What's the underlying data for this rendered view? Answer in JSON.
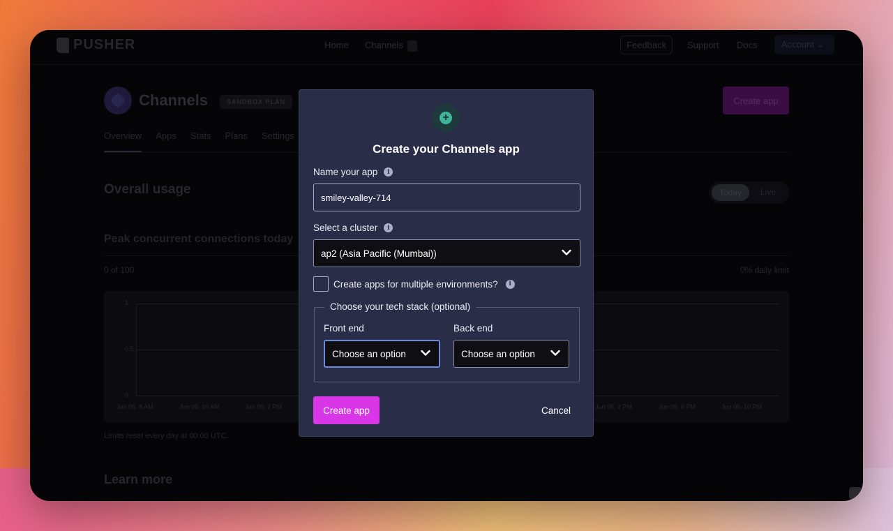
{
  "background_page": {
    "logo_text": "PUSHER",
    "nav": {
      "home": "Home",
      "channels": "Channels",
      "feedback": "Feedback",
      "support": "Support",
      "docs": "Docs",
      "account": "Account"
    },
    "page_title": "Channels",
    "plan_badge": "SANDBOX PLAN",
    "create_app_button": "Create app",
    "tabs": [
      "Overview",
      "Apps",
      "Stats",
      "Plans",
      "Settings"
    ],
    "section_title": "Overall usage",
    "toggle": {
      "today": "Today",
      "live": "Live"
    },
    "subsection_title": "Peak concurrent connections today",
    "count_text": "0 of 100",
    "limit_text": "0% daily limit",
    "chart_y_ticks": [
      "1",
      "0.5",
      "0"
    ],
    "chart_x_ticks": [
      "Jun 05, 8 AM",
      "Jun 05, 10 AM",
      "Jun 05, 2 PM",
      "Jun 05, 2 PM",
      "Jun 05, 8 PM",
      "Jun 05, 10 PM"
    ],
    "reset_note": "Limits reset every day at 00:00 UTC.",
    "learn_more": "Learn more"
  },
  "modal": {
    "title": "Create your Channels app",
    "icon": "plus-circle-icon",
    "name_label": "Name your app",
    "name_value": "smiley-valley-714",
    "cluster_label": "Select a cluster",
    "cluster_value": "ap2 (Asia Pacific (Mumbai))",
    "multi_env_label": "Create apps for multiple environments?",
    "multi_env_checked": false,
    "tech_stack_legend": "Choose your tech stack (optional)",
    "front_end_label": "Front end",
    "front_end_value": "Choose an option",
    "back_end_label": "Back end",
    "back_end_value": "Choose an option",
    "create_button": "Create app",
    "cancel_button": "Cancel"
  },
  "colors": {
    "modal_bg": "#2a2d48",
    "primary_button": "#d936e8",
    "focus_ring": "#6a8be0",
    "icon_accent": "#3fb59a"
  }
}
